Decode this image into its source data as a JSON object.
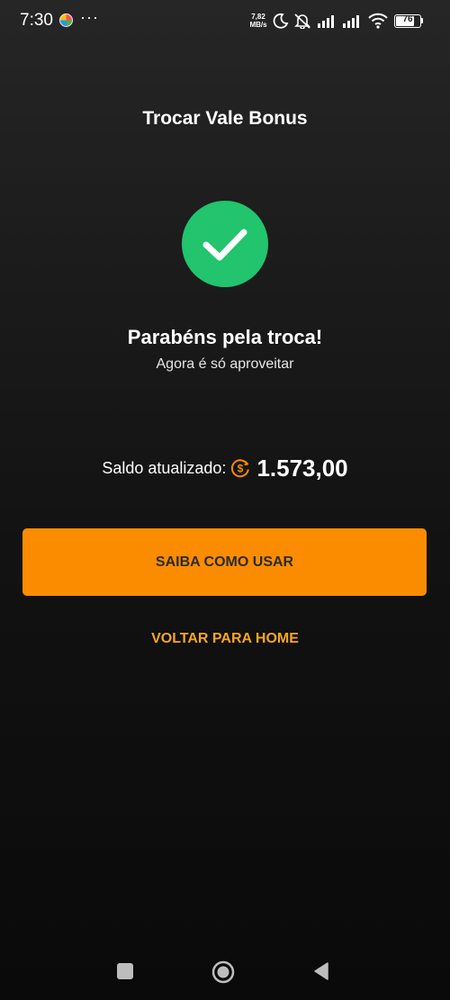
{
  "status_bar": {
    "time": "7:30",
    "more_indicator": "···",
    "net_speed_value": "7,82",
    "net_speed_unit": "MB/s",
    "battery_level": "76",
    "icons": [
      "app-notification-icon",
      "more-dots-icon",
      "moon-icon",
      "muted-bell-icon",
      "signal-icon",
      "signal-icon",
      "wifi-icon",
      "battery-icon"
    ]
  },
  "header": {
    "title": "Trocar Vale Bonus"
  },
  "success": {
    "icon": "checkmark-icon",
    "icon_color": "#22c46e",
    "title": "Parabéns pela troca!",
    "subtitle": "Agora é só aproveitar"
  },
  "balance": {
    "label": "Saldo atualizado:",
    "icon": "coin-icon",
    "icon_color": "#fb8c00",
    "value": "1.573,00"
  },
  "actions": {
    "primary_label": "SAIBA COMO USAR",
    "primary_color": "#fb8c00",
    "secondary_label": "VOLTAR PARA HOME",
    "secondary_color": "#f5a623"
  },
  "nav_bar": {
    "buttons": [
      "recents-square-icon",
      "home-circle-icon",
      "back-triangle-icon"
    ]
  }
}
